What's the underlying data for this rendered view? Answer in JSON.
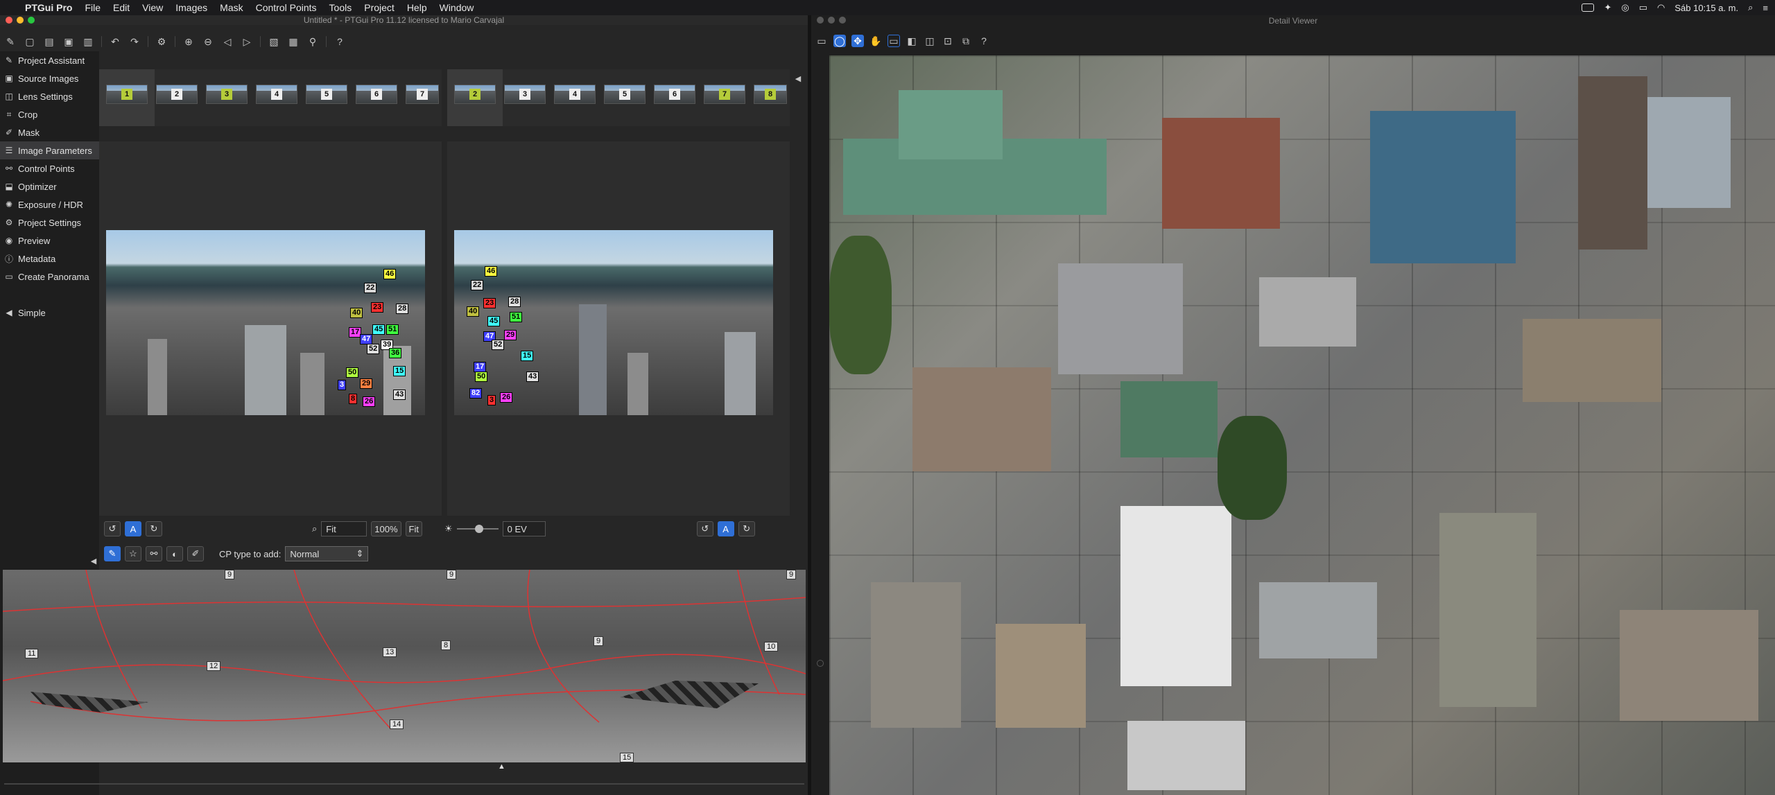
{
  "menubar": {
    "app": "PTGui Pro",
    "items": [
      "File",
      "Edit",
      "View",
      "Images",
      "Mask",
      "Control Points",
      "Tools",
      "Project",
      "Help",
      "Window"
    ],
    "clock": "Sáb 10:15 a. m."
  },
  "main_window": {
    "title": "Untitled * - PTGui Pro 11.12 licensed to Mario Carvajal"
  },
  "sidebar": {
    "items": [
      {
        "label": "Project Assistant",
        "icon": "wand-icon"
      },
      {
        "label": "Source Images",
        "icon": "image-icon"
      },
      {
        "label": "Lens Settings",
        "icon": "lens-icon"
      },
      {
        "label": "Crop",
        "icon": "crop-icon"
      },
      {
        "label": "Mask",
        "icon": "brush-icon"
      },
      {
        "label": "Image Parameters",
        "icon": "sliders-icon"
      },
      {
        "label": "Control Points",
        "icon": "link-icon"
      },
      {
        "label": "Optimizer",
        "icon": "optimizer-icon"
      },
      {
        "label": "Exposure / HDR",
        "icon": "exposure-icon"
      },
      {
        "label": "Project Settings",
        "icon": "gear-icon"
      },
      {
        "label": "Preview",
        "icon": "eye-icon"
      },
      {
        "label": "Metadata",
        "icon": "info-icon"
      },
      {
        "label": "Create Panorama",
        "icon": "panorama-icon"
      }
    ],
    "simple_label": "Simple"
  },
  "left_strip": {
    "thumbs": [
      "1",
      "2",
      "3",
      "4",
      "5",
      "6",
      "7"
    ],
    "selected": "1",
    "highlighted": [
      "1",
      "3"
    ]
  },
  "right_strip": {
    "thumbs": [
      "2",
      "3",
      "4",
      "5",
      "6",
      "7",
      "8"
    ],
    "selected": "2",
    "highlighted": [
      "2",
      "7",
      "8"
    ]
  },
  "left_image_cps": [
    "46",
    "22",
    "23",
    "28",
    "40",
    "17",
    "45",
    "51",
    "47",
    "39",
    "52",
    "36",
    "50",
    "15",
    "29",
    "43",
    "8",
    "26",
    "3"
  ],
  "right_image_cps": [
    "46",
    "22",
    "23",
    "28",
    "40",
    "51",
    "45",
    "47",
    "29",
    "52",
    "15",
    "17",
    "50",
    "43",
    "82",
    "26",
    "3"
  ],
  "controls": {
    "zoom_value": "Fit",
    "zoom_percent": "100%",
    "fit_label": "Fit",
    "ev_value": "0 EV",
    "cp_type_label": "CP type to add:",
    "cp_type_value": "Normal"
  },
  "pano_labels": [
    "9",
    "10",
    "11",
    "12",
    "13",
    "8",
    "14",
    "15",
    "9",
    "9",
    "9"
  ],
  "detail_window": {
    "title": "Detail Viewer"
  }
}
